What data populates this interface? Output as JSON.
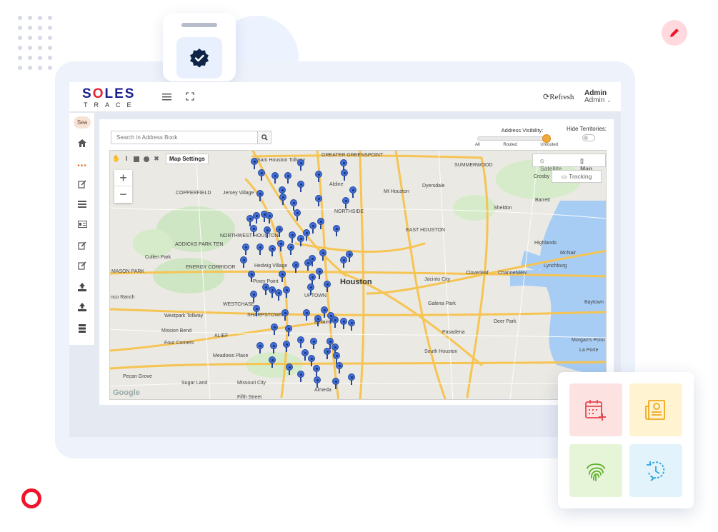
{
  "brand": {
    "logo_main_pre": "S",
    "logo_main_o": "O",
    "logo_main_post": "LES",
    "logo_sub": "TRACE"
  },
  "header": {
    "refresh_label": "Refresh",
    "user_name": "Admin",
    "user_role": "Admin"
  },
  "sidebar": {
    "search_label": "Sea"
  },
  "toolbar": {
    "address_placeholder": "Search in Address Book",
    "visibility_label": "Address Visibility:",
    "visibility_options": [
      "All",
      "Routed",
      "Unrouted"
    ],
    "visibility_value": "Unrouted",
    "hide_territories_label": "Hide Territories:"
  },
  "map": {
    "settings_label": "Map Settings",
    "satellite_label": "Satellite",
    "map_label": "Map",
    "tracking_label": "Tracking",
    "zoom_in": "+",
    "zoom_out": "−",
    "city_label": "Houston",
    "attribution": "Google",
    "places": {
      "jersey_village": "Jersey Village",
      "aldine": "Aldine",
      "mt_houston": "Mt Houston",
      "dyersdale": "Dyersdale",
      "crosby": "Crosby",
      "barrett": "Barrett",
      "sheldon": "Sheldon",
      "highlands": "Highlands",
      "mcnair": "McNair",
      "lynchburg": "Lynchburg",
      "channelview": "Channelview",
      "cloverleaf": "Cloverleaf",
      "jacinto_city": "Jacinto City",
      "galena_park": "Galena Park",
      "pasadena": "Pasadena",
      "deer_park": "Deer Park",
      "south_houston": "South Houston",
      "baytown": "Baytown",
      "la_porte": "La Porte",
      "morgans_point": "Morgan's Point",
      "cullen_park": "Cullen Park",
      "mason_park": "MASON PARK",
      "hedwig_village": "Hedwig Village",
      "piney_point": "Piney Point",
      "bellaire": "Bellaire",
      "mission_bend": "Mission Bend",
      "four_corners": "Four Corners",
      "meadows_place": "Meadows Place",
      "sugar_land": "Sugar Land",
      "missouri_city": "Missouri City",
      "pecan_grove": "Pecan Grove",
      "fifth_street": "Fifth Street",
      "almeda": "Almeda",
      "cinco_ranch": "nco Ranch",
      "summerwood": "SUMMERWOOD",
      "northside": "NORTHSIDE",
      "east_houston": "EAST HOUSTON",
      "sharpstown": "SHARPSTOWN",
      "westchase": "WESTCHASE",
      "alief": "ALIEF",
      "uptown": "UPTOWN",
      "copperfield": "COPPERFIELD",
      "addicks": "ADDICKS PARK TEN",
      "energy_corridor": "ENERGY CORRIDOR",
      "northwest_houston": "NORTHWEST HOUSTON",
      "greater_greenspoint": "GREATER GREENSPOINT",
      "sam_houston_tollway": "Sam Houston Tollway",
      "westpark_tollway": "Westpark Tollway"
    }
  },
  "colors": {
    "brand_blue": "#1a1f8f",
    "brand_red": "#e4242f",
    "pin": "#4170d8",
    "slider": "#f2a93b"
  },
  "icons": {
    "sidebar": [
      "home-icon",
      "more-icon",
      "edit-icon",
      "list-icon",
      "id-card-icon",
      "edit-icon",
      "edit-icon",
      "upload-icon",
      "upload-icon",
      "stack-icon"
    ],
    "floating_tiles": [
      "calendar-add-icon",
      "newspaper-icon",
      "fingerprint-icon",
      "history-clock-icon"
    ]
  }
}
